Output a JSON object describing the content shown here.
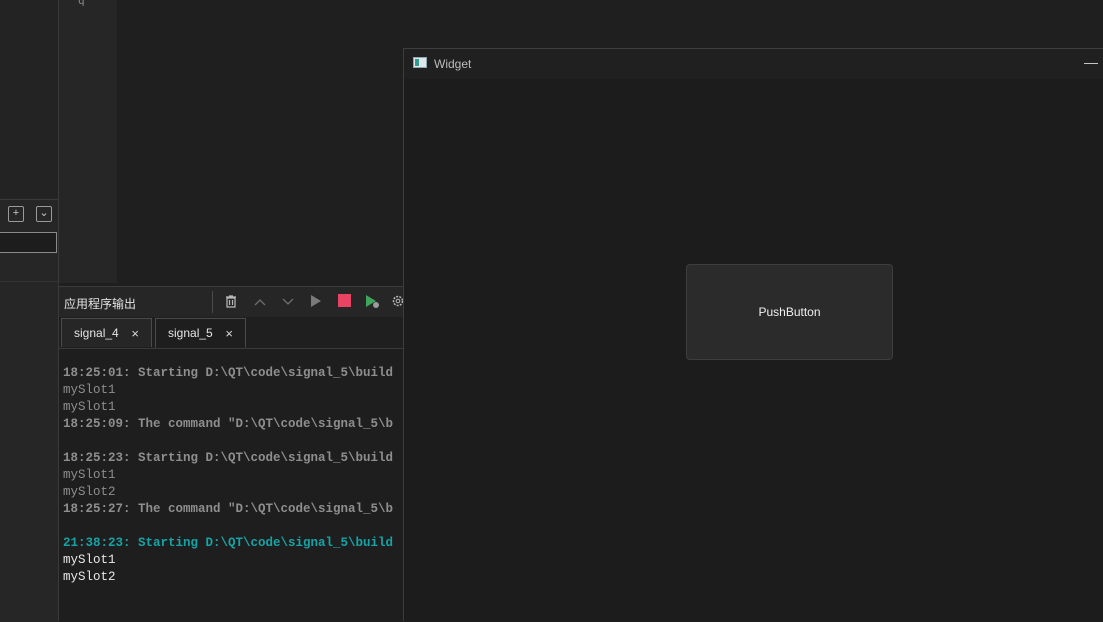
{
  "editor": {
    "gutter_mark": "q"
  },
  "output_panel": {
    "title": "应用程序输出",
    "toolbar": {
      "clear_icon": "trash-icon",
      "prev_icon": "chevron-up-icon",
      "next_icon": "chevron-down-icon",
      "run_icon": "play-icon",
      "stop_icon": "stop-icon",
      "debug_icon": "debug-run-icon",
      "settings_icon": "gear-icon"
    },
    "tabs": [
      {
        "label": "signal_4",
        "close": "×"
      },
      {
        "label": "signal_5",
        "close": "×"
      }
    ],
    "log": [
      {
        "text": "18:25:01: Starting D:\\QT\\code\\signal_5\\build",
        "style": "gray bold"
      },
      {
        "text": "mySlot1",
        "style": "gray"
      },
      {
        "text": "mySlot1",
        "style": "gray"
      },
      {
        "text": "18:25:09: The command \"D:\\QT\\code\\signal_5\\b",
        "style": "gray bold"
      },
      {
        "text": "",
        "style": "gray"
      },
      {
        "text": "18:25:23: Starting D:\\QT\\code\\signal_5\\build",
        "style": "gray bold"
      },
      {
        "text": "mySlot1",
        "style": "gray"
      },
      {
        "text": "mySlot2",
        "style": "gray"
      },
      {
        "text": "18:25:27: The command \"D:\\QT\\code\\signal_5\\b",
        "style": "gray bold"
      },
      {
        "text": "",
        "style": "gray"
      },
      {
        "text": "21:38:23: Starting D:\\QT\\code\\signal_5\\build",
        "style": "teal"
      },
      {
        "text": "mySlot1",
        "style": "white"
      },
      {
        "text": "mySlot2",
        "style": "white"
      }
    ]
  },
  "widget_window": {
    "title": "Widget",
    "minimize": "—",
    "button_label": "PushButton"
  },
  "colors": {
    "stop_red": "#e84362",
    "run_green": "#3fa55a",
    "teal_log": "#17a3a5"
  }
}
